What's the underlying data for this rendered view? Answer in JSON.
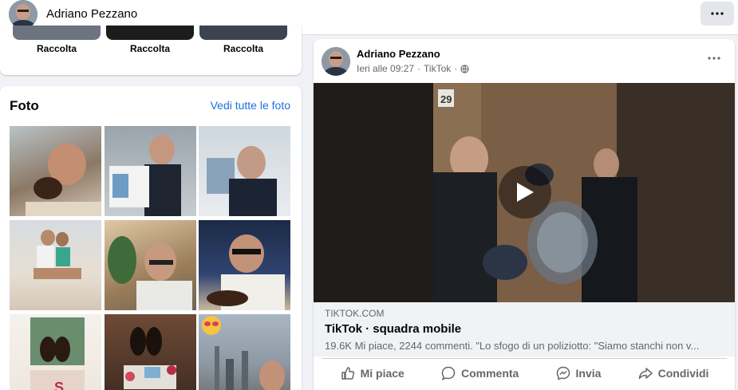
{
  "header": {
    "profile_name": "Adriano Pezzano",
    "more_label": "···"
  },
  "collections": {
    "items": [
      {
        "label": "Raccolta"
      },
      {
        "label": "Raccolta"
      },
      {
        "label": "Raccolta"
      }
    ]
  },
  "photos": {
    "title": "Foto",
    "see_all": "Vedi tutte le foto"
  },
  "post": {
    "author": "Adriano Pezzano",
    "time": "Ieri alle 09:27",
    "source": "TikTok",
    "separator": "·",
    "video": {
      "door_number": "29"
    },
    "link": {
      "domain": "TIKTOK.COM",
      "title": "TikTok · squadra mobile",
      "description": "19.6K Mi piace, 2244 commenti. \"Lo sfogo di un poliziotto: \"Siamo stanchi non v..."
    },
    "actions": {
      "like": "Mi piace",
      "comment": "Commenta",
      "send": "Invia",
      "share": "Condividi"
    }
  },
  "colors": {
    "link_blue": "#216fdb",
    "muted": "#65676b",
    "background": "#f0f2f5"
  }
}
